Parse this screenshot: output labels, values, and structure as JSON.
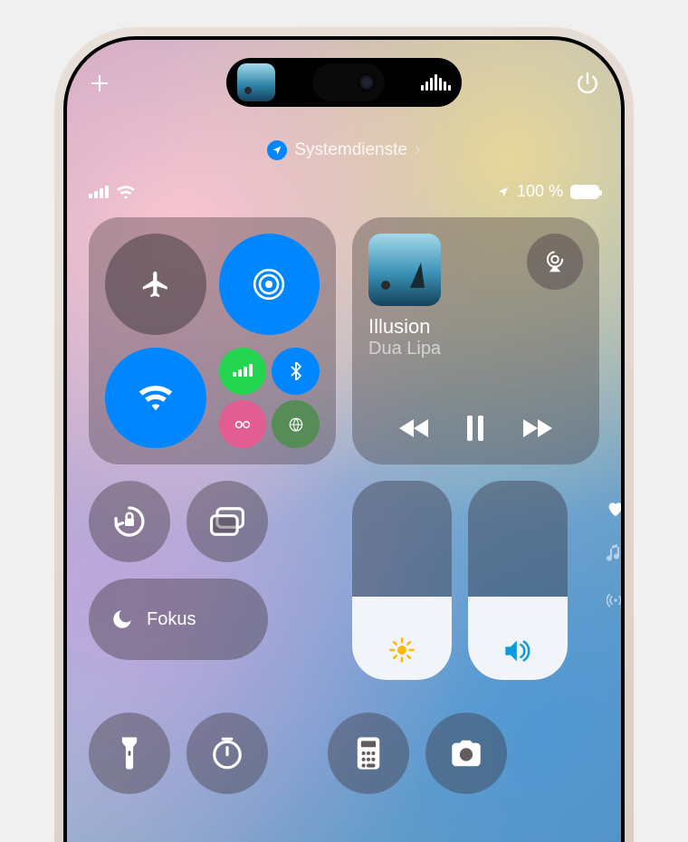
{
  "system_services": {
    "label": "Systemdienste"
  },
  "status": {
    "battery_text": "100 %"
  },
  "media": {
    "track_title": "Illusion",
    "track_artist": "Dua Lipa"
  },
  "focus": {
    "label": "Fokus"
  },
  "sliders": {
    "brightness_pct": 42,
    "volume_pct": 42
  },
  "colors": {
    "accent_blue": "#0a84ff",
    "accent_green": "#30d158"
  },
  "icons": {
    "add": "plus-icon",
    "power": "power-icon",
    "location": "location-arrow-icon",
    "airplane": "airplane-icon",
    "airdrop": "airdrop-icon",
    "wifi": "wifi-icon",
    "cellular": "cellular-icon",
    "bluetooth": "bluetooth-icon",
    "hotspot": "hotspot-icon",
    "vpn": "vpn-icon",
    "airplay": "airplay-icon",
    "rewind": "rewind-icon",
    "pause": "pause-icon",
    "forward": "forward-icon",
    "rotation_lock": "rotation-lock-icon",
    "screen_mirror": "screen-mirror-icon",
    "moon": "moon-icon",
    "brightness": "sun-icon",
    "volume": "speaker-icon",
    "flashlight": "flashlight-icon",
    "timer": "timer-icon",
    "calculator": "calculator-icon",
    "camera": "camera-icon",
    "heart": "heart-icon",
    "music": "music-note-icon",
    "broadcast": "broadcast-icon"
  }
}
